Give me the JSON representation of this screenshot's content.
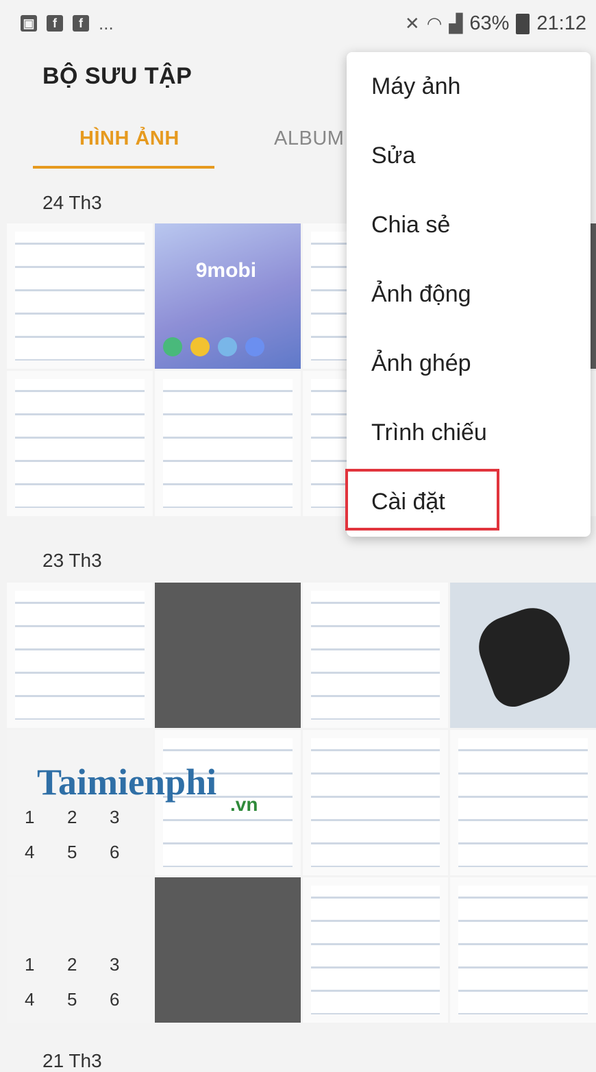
{
  "status_bar": {
    "left_icons": [
      "image-icon",
      "facebook-icon",
      "facebook-icon"
    ],
    "left_more": "...",
    "battery_percent": "63%",
    "time": "21:12"
  },
  "header": {
    "title": "BỘ SƯU TẬP"
  },
  "tabs": {
    "active": "HÌNH ẢNH",
    "second": "ALBUM"
  },
  "sections": [
    {
      "date": "24 Th3"
    },
    {
      "date": "23 Th3"
    },
    {
      "date": "21 Th3"
    }
  ],
  "thumbnails": {
    "logo_text": "9mobi",
    "keypad_digits": [
      "1",
      "2",
      "3",
      "4",
      "5",
      "6"
    ]
  },
  "watermark": {
    "main": "Taimienphi",
    "suffix": ".vn"
  },
  "menu": {
    "items": [
      "Máy ảnh",
      "Sửa",
      "Chia sẻ",
      "Ảnh động",
      "Ảnh ghép",
      "Trình chiếu",
      "Cài đặt"
    ],
    "highlighted": "Cài đặt"
  },
  "colors": {
    "accent": "#e69a1f",
    "highlight_border": "#e1343d"
  }
}
